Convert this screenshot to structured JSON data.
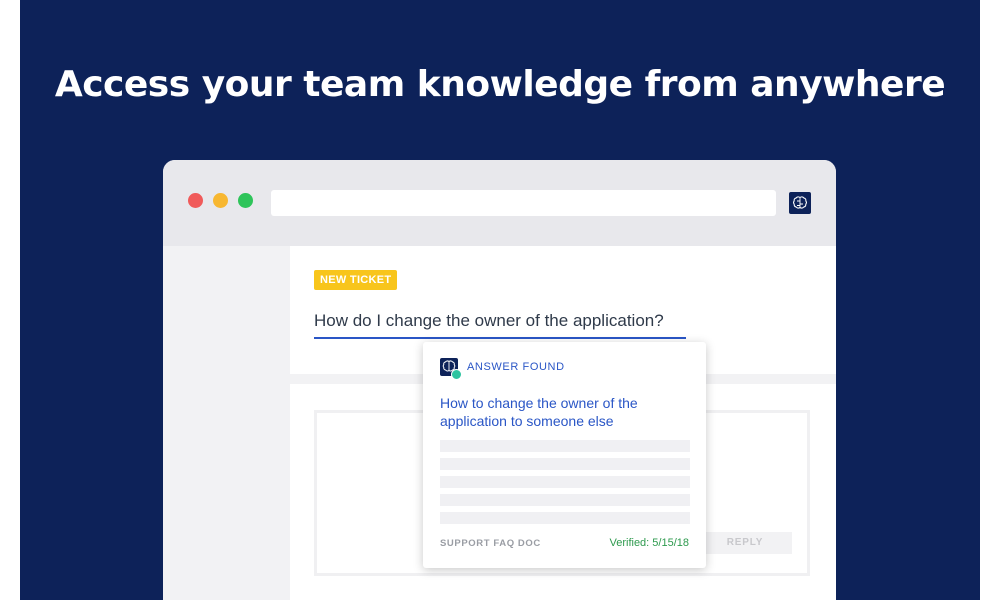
{
  "headline": "Access your team knowledge from anywhere",
  "ticket": {
    "badge": "NEW TICKET",
    "question": "How do I change the owner of the application?",
    "reply_label": "REPLY"
  },
  "answer_card": {
    "status": "ANSWER FOUND",
    "title": "How to change the owner of the application to someone else",
    "source": "SUPPORT FAQ DOC",
    "verified": "Verified: 5/15/18"
  },
  "colors": {
    "brand_navy": "#0d2259",
    "badge_yellow": "#f8c51c",
    "link_blue": "#2a56c6",
    "verified_green": "#2e9a4e"
  },
  "icons": {
    "extension": "brain-icon",
    "card": "brain-icon"
  }
}
